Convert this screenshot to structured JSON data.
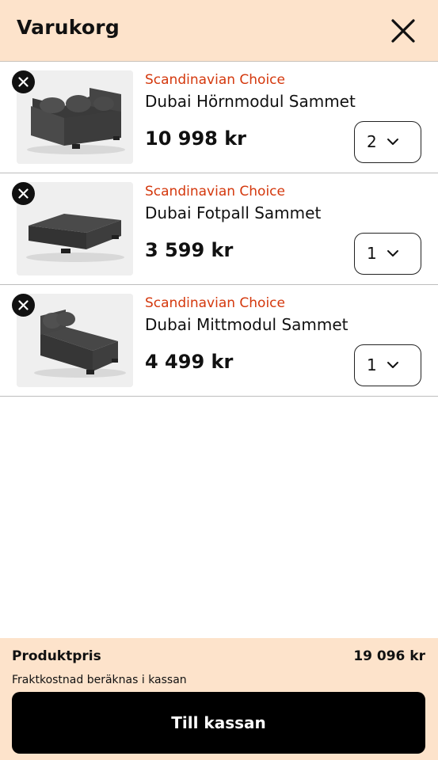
{
  "header": {
    "title": "Varukorg",
    "close_icon": "close-icon"
  },
  "cart": {
    "items": [
      {
        "brand": "Scandinavian Choice",
        "name": "Dubai Hörnmodul Sammet",
        "price": "10 998 kr",
        "quantity": "2"
      },
      {
        "brand": "Scandinavian Choice",
        "name": "Dubai Fotpall Sammet",
        "price": "3 599 kr",
        "quantity": "1"
      },
      {
        "brand": "Scandinavian Choice",
        "name": "Dubai Mittmodul Sammet",
        "price": "4 499 kr",
        "quantity": "1"
      }
    ]
  },
  "summary": {
    "product_price_label": "Produktpris",
    "product_price_value": "19 096 kr",
    "shipping_note": "Fraktkostnad beräknas i kassan",
    "checkout_label": "Till kassan"
  },
  "colors": {
    "header_bg": "#fde3cb",
    "brand": "#d4380d",
    "button_bg": "#000000"
  }
}
